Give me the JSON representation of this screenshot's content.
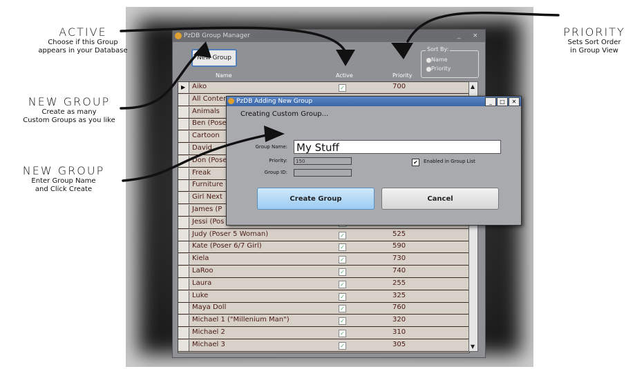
{
  "callouts": {
    "active": {
      "head": "ACTIVE",
      "line1": "Choose if this Group",
      "line2": "appears in your Database"
    },
    "new_group_1": {
      "head": "NEW GROUP",
      "line1": "Create as many",
      "line2": "Custom Groups as you like"
    },
    "new_group_2": {
      "head": "NEW GROUP",
      "line1": "Enter Group Name",
      "line2": "and Click Create"
    },
    "priority": {
      "head": "PRIORITY",
      "line1": "Sets Sort Order",
      "line2": "in Group View"
    }
  },
  "main_window": {
    "title": "PzDB Group Manager",
    "minimize": "_",
    "close": "×",
    "new_group_label": "New Group",
    "sort": {
      "label": "Sort By:",
      "options": [
        "Name",
        "Priority"
      ]
    },
    "columns": {
      "name": "Name",
      "active": "Active",
      "priority": "Priority"
    },
    "rows": [
      {
        "name": "Aiko",
        "priority": "700",
        "active": true
      },
      {
        "name": "All Content",
        "priority": "",
        "active": true
      },
      {
        "name": "Animals",
        "priority": "",
        "active": true
      },
      {
        "name": "Ben (Poser",
        "priority": "",
        "active": true
      },
      {
        "name": "Cartoon",
        "priority": "",
        "active": true
      },
      {
        "name": "David",
        "priority": "",
        "active": true
      },
      {
        "name": "Don (Poser",
        "priority": "",
        "active": true
      },
      {
        "name": "Freak",
        "priority": "",
        "active": true
      },
      {
        "name": "Furniture",
        "priority": "",
        "active": true
      },
      {
        "name": "Girl Next",
        "priority": "",
        "active": true
      },
      {
        "name": "James (P",
        "priority": "",
        "active": true
      },
      {
        "name": "Jessi (Pos",
        "priority": "",
        "active": true
      },
      {
        "name": "Judy (Poser 5 Woman)",
        "priority": "525",
        "active": true
      },
      {
        "name": "Kate (Poser 6/7 Girl)",
        "priority": "590",
        "active": true
      },
      {
        "name": "Kiela",
        "priority": "730",
        "active": true
      },
      {
        "name": "LaRoo",
        "priority": "740",
        "active": true
      },
      {
        "name": "Laura",
        "priority": "255",
        "active": true
      },
      {
        "name": "Luke",
        "priority": "325",
        "active": true
      },
      {
        "name": "Maya Doll",
        "priority": "760",
        "active": true
      },
      {
        "name": "Michael 1 (\"Millenium Man\")",
        "priority": "320",
        "active": true
      },
      {
        "name": "Michael 2",
        "priority": "310",
        "active": true
      },
      {
        "name": "Michael 3",
        "priority": "305",
        "active": true
      }
    ]
  },
  "dialog": {
    "title": "PzDB Adding New Group",
    "heading": "Creating Custom Group...",
    "group_name_label": "Group Name:",
    "group_name_value": "My Stuff",
    "priority_label": "Priority:",
    "priority_value": "150",
    "group_id_label": "Group ID:",
    "group_id_value": "",
    "enabled_label": "Enabled in Group List",
    "create_label": "Create Group",
    "cancel_label": "Cancel"
  }
}
